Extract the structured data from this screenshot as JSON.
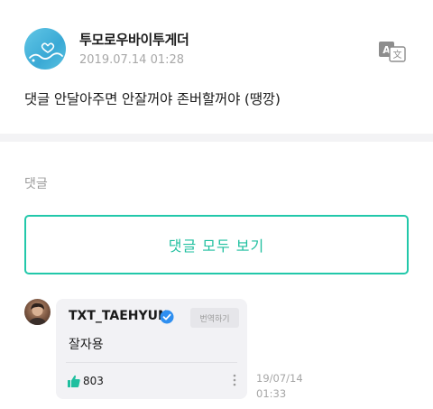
{
  "post": {
    "author": "투모로우바이투게더",
    "timestamp": "2019.07.14 01:28",
    "body": "댓글 안달아주면 안잘꺼야 존버할꺼야 (땡깡)",
    "translate_icon": "translate-icon"
  },
  "comments_section": {
    "heading": "댓글",
    "view_all_label": "댓글 모두 보기"
  },
  "comment": {
    "username": "TXT_TAEHYUN",
    "verified_icon": "verified-badge-icon",
    "translate_label": "번역하기",
    "text": "잘자용",
    "like_icon": "thumbs-up-icon",
    "like_count": "803",
    "more_icon": "more-vertical-icon",
    "date": "19/07/14",
    "time": "01:33"
  },
  "colors": {
    "accent": "#1fbf9f",
    "verified": "#2f8ff0",
    "divider": "#f3f3f5"
  }
}
